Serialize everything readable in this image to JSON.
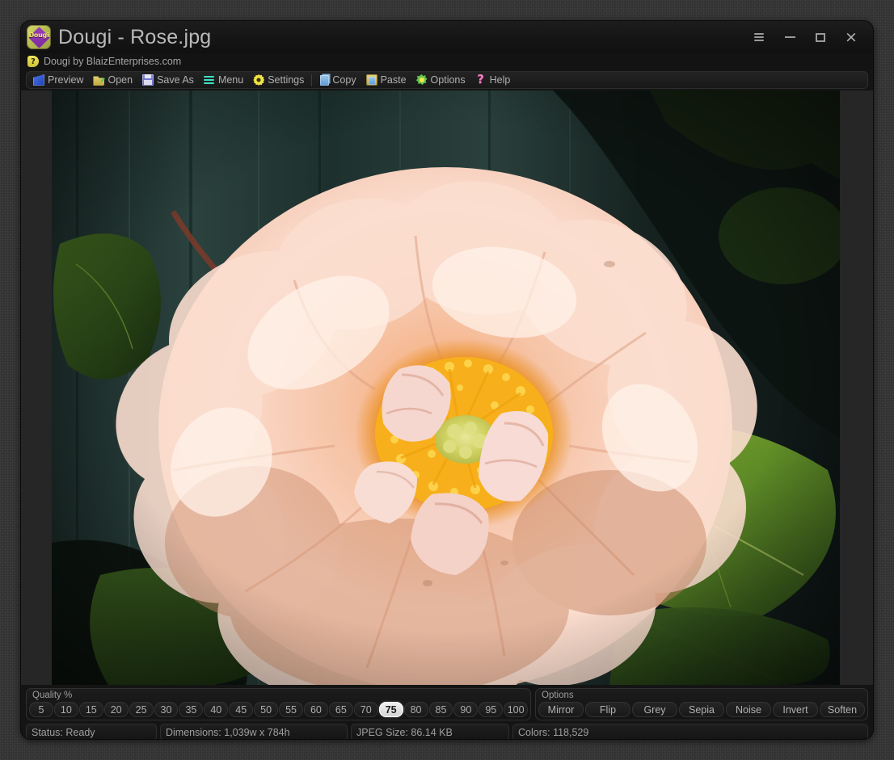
{
  "window": {
    "title": "Dougi - Rose.jpg",
    "app_icon": "dougi-app-icon",
    "icon_word": "Dougi",
    "subtitle": "Dougi by BlaizEnterprises.com",
    "subtitle_badge": "?",
    "controls": {
      "stack_label": "menu-stack",
      "minimize_label": "Minimize",
      "maximize_label": "Maximize",
      "close_label": "×"
    }
  },
  "toolbar": {
    "items": [
      {
        "label": "Preview",
        "icon": "preview-icon"
      },
      {
        "label": "Open",
        "icon": "open-folder-icon"
      },
      {
        "label": "Save As",
        "icon": "floppy-save-icon"
      },
      {
        "label": "Menu",
        "icon": "hamburger-menu-icon"
      },
      {
        "label": "Settings",
        "icon": "gear-icon"
      },
      {
        "label": "Copy",
        "icon": "copy-icon"
      },
      {
        "label": "Paste",
        "icon": "paste-icon"
      },
      {
        "label": "Options",
        "icon": "flower-options-icon"
      },
      {
        "label": "Help",
        "icon": "question-mark-icon"
      }
    ]
  },
  "quality": {
    "panel_title": "Quality %",
    "selected": "75",
    "values": [
      "5",
      "10",
      "15",
      "20",
      "25",
      "30",
      "35",
      "40",
      "45",
      "50",
      "55",
      "60",
      "65",
      "70",
      "75",
      "80",
      "85",
      "90",
      "95",
      "100"
    ]
  },
  "options": {
    "panel_title": "Options",
    "buttons": [
      "Mirror",
      "Flip",
      "Grey",
      "Sepia",
      "Noise",
      "Invert",
      "Soften"
    ]
  },
  "status": {
    "state": "Status: Ready",
    "dimensions": "Dimensions: 1,039w x 784h",
    "jpeg_size": "JPEG Size: 86.14 KB",
    "colors": "Colors: 118,529"
  },
  "image": {
    "subject": "pale-pink-rose-photograph",
    "colors": {
      "fence_dark": "#1d2b2a",
      "fence_mid": "#2c3f3c",
      "leaf_green": "#5e8b2a",
      "leaf_dark": "#2f4a1c",
      "petal_light": "#fbe0d4",
      "petal_mid": "#f0c4ae",
      "petal_shadow": "#d99a7f",
      "stamen_gold": "#f0a818",
      "pistil_green": "#d8d86a"
    }
  }
}
